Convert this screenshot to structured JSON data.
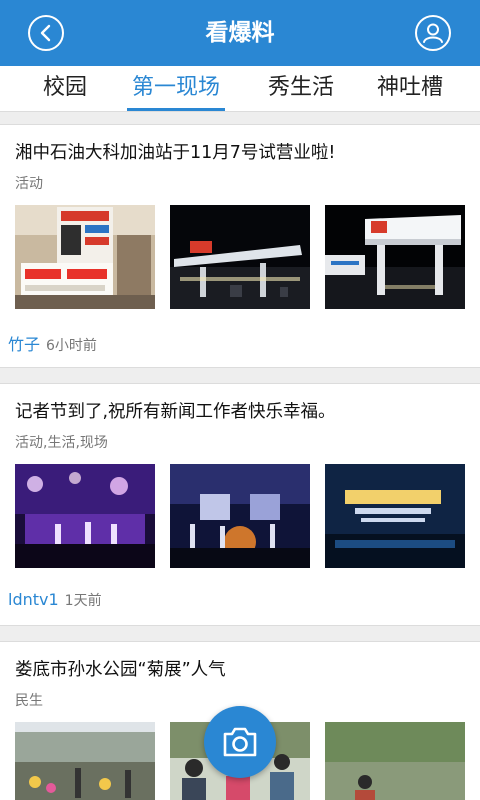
{
  "header": {
    "title": "看爆料",
    "back_icon": "chevron-left-icon",
    "user_icon": "user-icon"
  },
  "tabs": [
    {
      "label": "校园",
      "active": false
    },
    {
      "label": "第一现场",
      "active": true
    },
    {
      "label": "秀生活",
      "active": false
    },
    {
      "label": "神吐槽",
      "active": false
    }
  ],
  "posts": [
    {
      "title": "湘中石油大科加油站于11月7号试营业啦!",
      "tags": "活动",
      "author": "竹子",
      "time": "6小时前",
      "images": [
        "gas-station-sign-photo",
        "gas-station-night-photo",
        "gas-station-canopy-photo"
      ]
    },
    {
      "title": "记者节到了,祝所有新闻工作者快乐幸福。",
      "tags": "活动,生活,现场",
      "author": "ldntv1",
      "time": "1天前",
      "images": [
        "stage-performance-photo",
        "stage-dancers-photo",
        "stage-banner-photo"
      ]
    },
    {
      "title": "娄底市孙水公园“菊展”人气",
      "tags": "民生",
      "images": [
        "park-flower-show-photo",
        "park-crowd-photo",
        "park-visitors-photo"
      ]
    }
  ],
  "fab": {
    "icon": "camera-icon"
  },
  "colors": {
    "accent": "#2a87d3",
    "background": "#eeeeee"
  }
}
